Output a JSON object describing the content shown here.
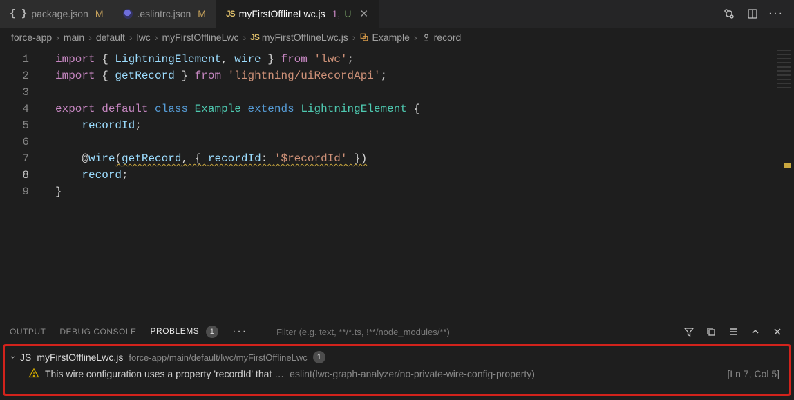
{
  "tabs": [
    {
      "icon": "braces",
      "label": "package.json",
      "suffix": "M",
      "kind": "modified",
      "active": false,
      "closable": false
    },
    {
      "icon": "eslint",
      "label": ".eslintrc.json",
      "suffix": "M",
      "kind": "modified",
      "active": false,
      "closable": false
    },
    {
      "icon": "js",
      "label": "myFirstOfflineLwc.js",
      "suffix": "1, U",
      "kind": "problems-untracked",
      "active": true,
      "closable": true
    }
  ],
  "titlebar_actions": {
    "compare": "compare-changes",
    "split": "split-editor",
    "more": "more-actions"
  },
  "breadcrumb": {
    "segments": [
      "force-app",
      "main",
      "default",
      "lwc",
      "myFirstOfflineLwc"
    ],
    "file": "myFirstOfflineLwc.js",
    "symbols": [
      {
        "icon": "class",
        "label": "Example"
      },
      {
        "icon": "field",
        "label": "record"
      }
    ]
  },
  "editor": {
    "active_line": 8,
    "lines": [
      {
        "n": 1,
        "tokens": [
          [
            "kw",
            "import"
          ],
          [
            "punc",
            " { "
          ],
          [
            "id",
            "LightningElement"
          ],
          [
            "punc",
            ", "
          ],
          [
            "id",
            "wire"
          ],
          [
            "punc",
            " } "
          ],
          [
            "kw",
            "from"
          ],
          [
            "punc",
            " "
          ],
          [
            "str",
            "'lwc'"
          ],
          [
            "punc",
            ";"
          ]
        ]
      },
      {
        "n": 2,
        "tokens": [
          [
            "kw",
            "import"
          ],
          [
            "punc",
            " { "
          ],
          [
            "id",
            "getRecord"
          ],
          [
            "punc",
            " } "
          ],
          [
            "kw",
            "from"
          ],
          [
            "punc",
            " "
          ],
          [
            "str",
            "'lightning/uiRecordApi'"
          ],
          [
            "punc",
            ";"
          ]
        ]
      },
      {
        "n": 3,
        "tokens": []
      },
      {
        "n": 4,
        "tokens": [
          [
            "kw",
            "export"
          ],
          [
            "punc",
            " "
          ],
          [
            "kw",
            "default"
          ],
          [
            "punc",
            " "
          ],
          [
            "store",
            "class"
          ],
          [
            "punc",
            " "
          ],
          [
            "type",
            "Example"
          ],
          [
            "punc",
            " "
          ],
          [
            "store",
            "extends"
          ],
          [
            "punc",
            " "
          ],
          [
            "type",
            "LightningElement"
          ],
          [
            "punc",
            " {"
          ]
        ]
      },
      {
        "n": 5,
        "tokens": [
          [
            "punc",
            "    "
          ],
          [
            "id",
            "recordId"
          ],
          [
            "punc",
            ";"
          ]
        ]
      },
      {
        "n": 6,
        "tokens": []
      },
      {
        "n": 7,
        "tokens": [
          [
            "punc",
            "    "
          ],
          [
            "dec",
            "@"
          ],
          [
            "id",
            "wire"
          ],
          [
            "wavy-start",
            ""
          ],
          [
            "punc",
            "("
          ],
          [
            "id",
            "getRecord"
          ],
          [
            "punc",
            ", { "
          ],
          [
            "id",
            "recordId"
          ],
          [
            "punc",
            ": "
          ],
          [
            "str",
            "'$recordId'"
          ],
          [
            "punc",
            " })"
          ],
          [
            "wavy-end",
            ""
          ]
        ]
      },
      {
        "n": 8,
        "tokens": [
          [
            "punc",
            "    "
          ],
          [
            "id",
            "record"
          ],
          [
            "punc",
            ";"
          ]
        ]
      },
      {
        "n": 9,
        "tokens": [
          [
            "punc",
            "}"
          ]
        ]
      }
    ]
  },
  "panel": {
    "tabs": [
      {
        "id": "output",
        "label": "OUTPUT",
        "active": false
      },
      {
        "id": "debug",
        "label": "DEBUG CONSOLE",
        "active": false
      },
      {
        "id": "problems",
        "label": "PROBLEMS",
        "active": true,
        "badge": "1"
      }
    ],
    "filter_placeholder": "Filter (e.g. text, **/*.ts, !**/node_modules/**)",
    "actions": [
      "filter-icon",
      "copy-icon",
      "view-as-list-icon",
      "collapse-icon",
      "close-icon"
    ],
    "problems": {
      "file": {
        "name": "myFirstOfflineLwc.js",
        "path": "force-app/main/default/lwc/myFirstOfflineLwc",
        "count": "1"
      },
      "items": [
        {
          "severity": "warning",
          "message": "This wire configuration uses a property 'recordId' that …",
          "source": "eslint(lwc-graph-analyzer/no-private-wire-config-property)",
          "location": "[Ln 7, Col 5]"
        }
      ]
    }
  }
}
